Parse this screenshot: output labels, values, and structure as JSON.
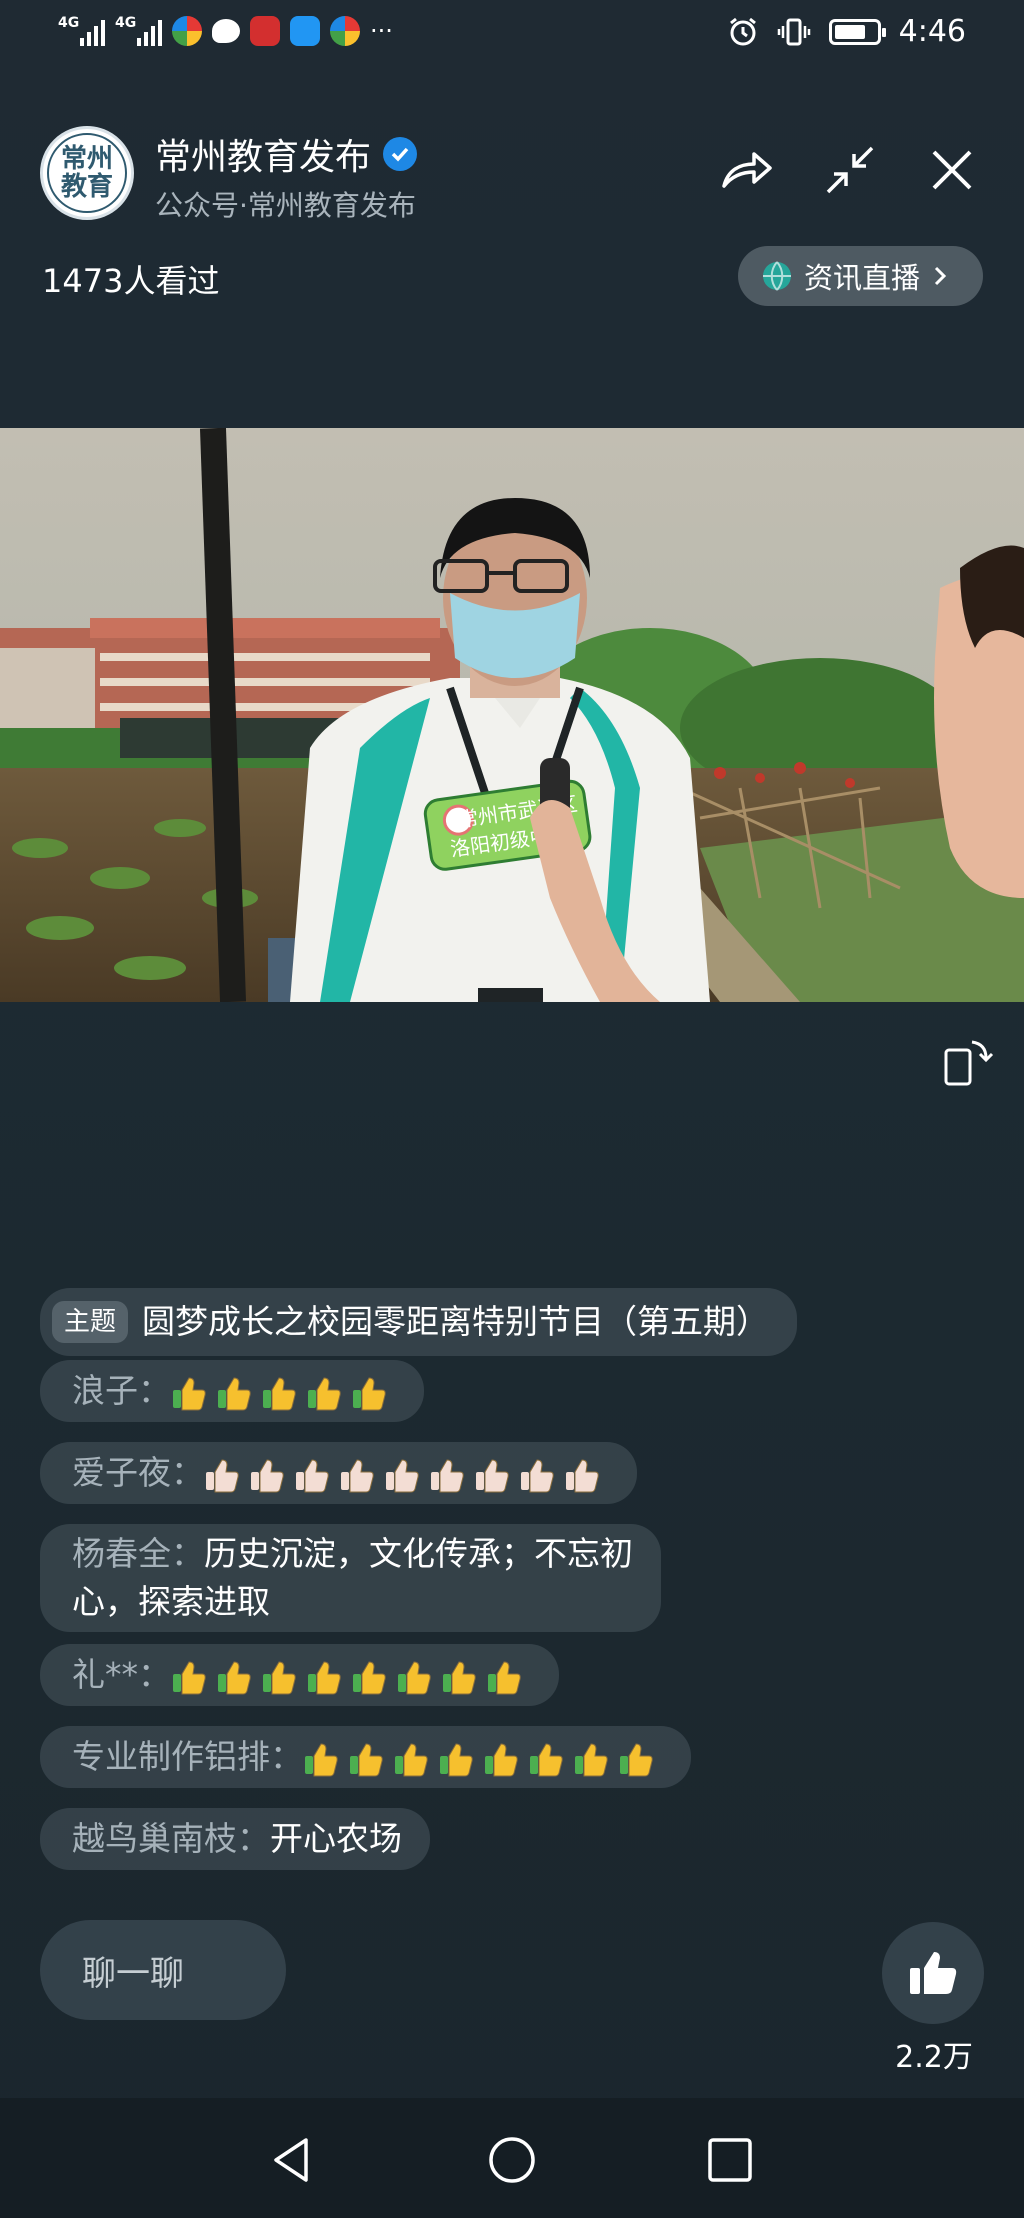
{
  "status_bar": {
    "net1": "4G",
    "net2": "4G",
    "more": "···",
    "time": "4:46",
    "battery_level": 0.75
  },
  "header": {
    "avatar_text": "常州\n教育",
    "account_name": "常州教育发布",
    "account_sub": "公众号·常州教育发布",
    "views": "1473人看过",
    "live_pill_label": "资讯直播",
    "icons": [
      "share-icon",
      "minimize-icon",
      "close-icon",
      "globe-icon",
      "chevron-right-icon"
    ]
  },
  "video": {
    "badge_text_line1": "常州市武进区",
    "badge_text_line2": "洛阳初级中学"
  },
  "chat": {
    "topic_tag": "主题",
    "topic_text": "圆梦成长之校园零距离特别节目（第五期）",
    "messages": [
      {
        "nick": "浪子：",
        "text": "",
        "emoji": "thumbs-up-yellow",
        "emoji_count": 5
      },
      {
        "nick": "爱子夜：",
        "text": "",
        "emoji": "thumbs-up-light",
        "emoji_count": 9
      },
      {
        "nick": "杨春全：",
        "text": "历史沉淀，文化传承；不忘初",
        "text2": "心，探索进取"
      },
      {
        "nick": "礼**：",
        "text": "",
        "emoji": "thumbs-up-yellow",
        "emoji_count": 8
      },
      {
        "nick": "专业制作铝排：",
        "text": "",
        "emoji": "thumbs-up-yellow",
        "emoji_count": 8
      },
      {
        "nick": "越鸟巢南枝：",
        "text": "开心农场"
      }
    ]
  },
  "bottom": {
    "chat_placeholder": "聊一聊",
    "like_count": "2.2万"
  },
  "colors": {
    "background": "#1f2a33",
    "pill": "#4e5a62",
    "verified": "#1e88e5",
    "nick": "#a6b2ba"
  }
}
